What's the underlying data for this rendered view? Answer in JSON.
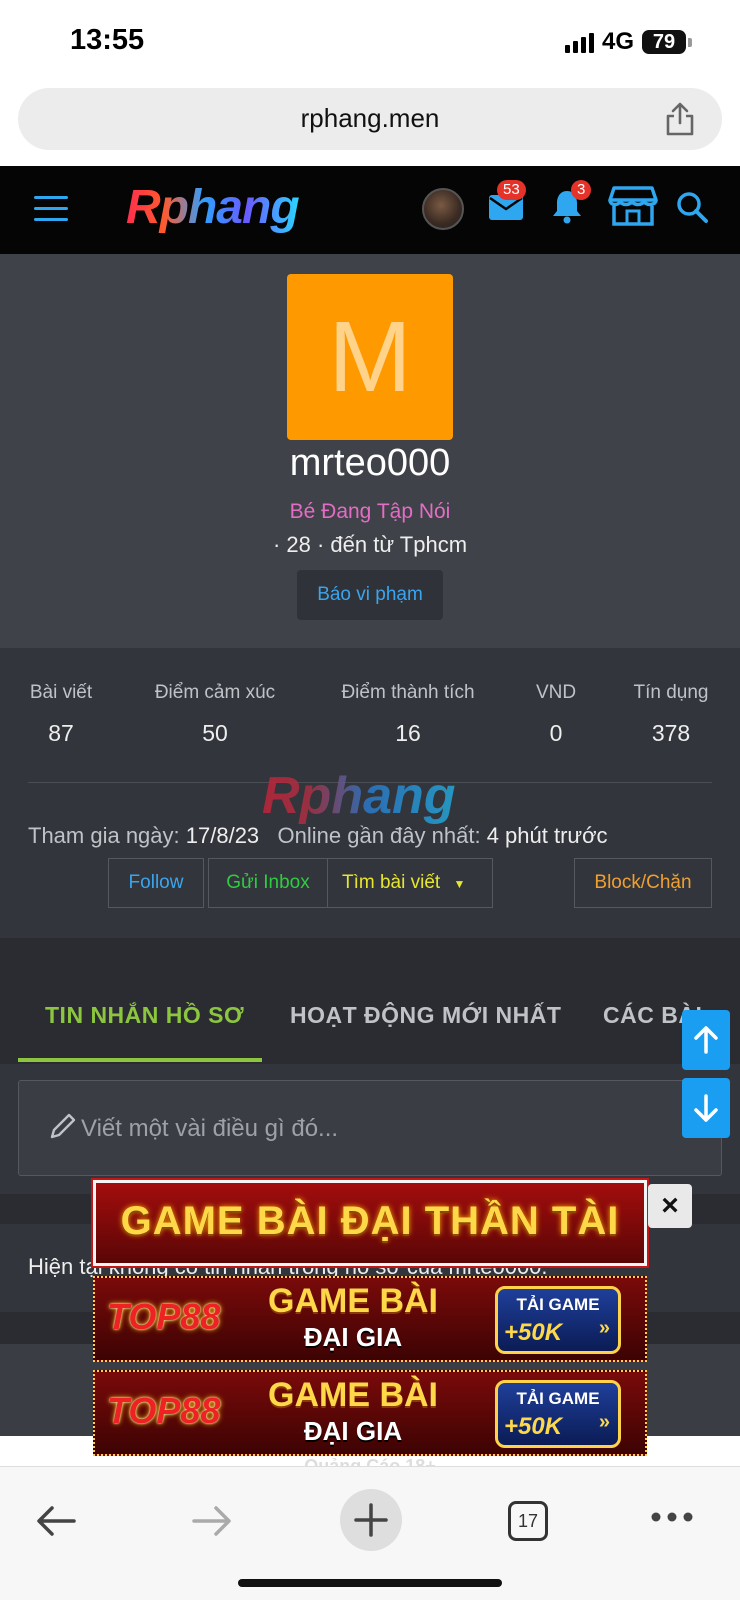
{
  "status_bar": {
    "time": "13:55",
    "network": "4G",
    "battery": "79"
  },
  "browser": {
    "url": "rphang.men",
    "tabs_count": "17"
  },
  "header": {
    "logo": "Rphang",
    "messages_badge": "53",
    "alerts_badge": "3"
  },
  "profile": {
    "avatar_letter": "M",
    "username": "mrteo000",
    "user_title": "Bé Đang Tập Nói",
    "meta": "· 28 · đến từ Tphcm",
    "report_label": "Báo vi phạm"
  },
  "stats": [
    {
      "label": "Bài viết",
      "value": "87"
    },
    {
      "label": "Điểm cảm xúc",
      "value": "50"
    },
    {
      "label": "Điểm thành tích",
      "value": "16"
    },
    {
      "label": "VND",
      "value": "0"
    },
    {
      "label": "Tín dụng",
      "value": "378"
    }
  ],
  "join": {
    "joined_label": "Tham gia ngày:",
    "joined_value": "17/8/23",
    "online_label": "Online gần đây nhất:",
    "online_value": "4 phút trước"
  },
  "actions": {
    "follow": "Follow",
    "inbox": "Gửi Inbox",
    "find_posts": "Tìm bài viết",
    "block": "Block/Chặn"
  },
  "tabs": [
    "TIN NHẮN HỒ SƠ",
    "HOẠT ĐỘNG MỚI NHẤT",
    "CÁC BÀI"
  ],
  "composer": {
    "placeholder": "Viết một vài điều gì đó..."
  },
  "messages": {
    "empty_text": "Hiện tại không có tin nhắn trong hồ sơ của mrteo000."
  },
  "ads": {
    "banner1": "GAME BÀI ĐẠI THẦN TÀI",
    "close": "×",
    "banner2_logo": "TOP88",
    "banner2_title": "GAME BÀI",
    "banner2_sub": "ĐẠI GIA",
    "banner2_cta_top": "TẢI GAME",
    "banner2_cta_bottom": "+50K",
    "caption": "Quảng Cáo 18+"
  },
  "colors": {
    "accent_blue": "#2ea7f0",
    "active_tab_green": "#8cc63f",
    "avatar_orange": "#ff9900",
    "title_pink": "#e46cc4",
    "badge_red": "#e5332a"
  }
}
